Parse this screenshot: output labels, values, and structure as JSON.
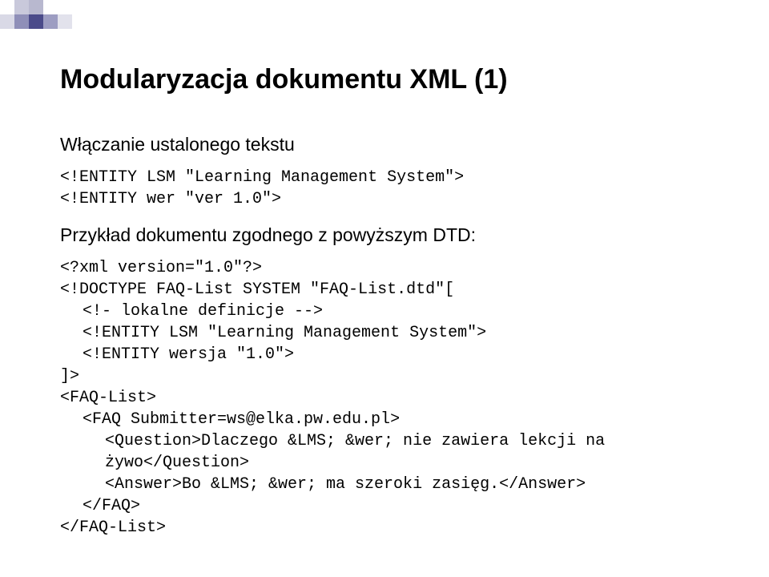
{
  "title": "Modularyzacja dokumentu XML (1)",
  "section1": {
    "heading": "Włączanie ustalonego tekstu",
    "line1": "<!ENTITY LSM \"Learning Management System\">",
    "line2": "<!ENTITY wer \"ver 1.0\">"
  },
  "section2": {
    "heading": "Przykład dokumentu zgodnego z powyższym DTD:",
    "line1": "<?xml version=\"1.0\"?>",
    "line2": "<!DOCTYPE FAQ-List SYSTEM \"FAQ-List.dtd\"[",
    "line3": "<!- lokalne definicje -->",
    "line4": "<!ENTITY LSM \"Learning Management System\">",
    "line5": "<!ENTITY wersja \"1.0\">",
    "line6": "]>",
    "line7": "<FAQ-List>",
    "line8": "<FAQ Submitter=ws@elka.pw.edu.pl>",
    "line9": "<Question>Dlaczego &LMS; &wer; nie zawiera lekcji na",
    "line10": "żywo</Question>",
    "line11": "<Answer>Bo &LMS; &wer; ma szeroki zasięg.</Answer>",
    "line12": "</FAQ>",
    "line13": "</FAQ-List>"
  }
}
